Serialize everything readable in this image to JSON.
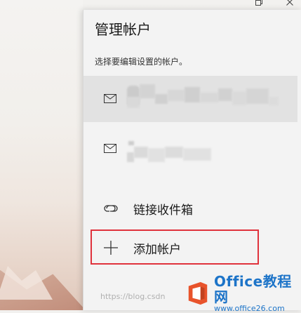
{
  "panel": {
    "title": "管理帐户",
    "subtitle": "选择要编辑设置的帐户。"
  },
  "accounts": [
    {
      "icon": "mail-icon",
      "selected": true
    },
    {
      "icon": "mail-icon",
      "selected": false
    }
  ],
  "menu": {
    "link_inbox": {
      "icon": "link-icon",
      "label": "链接收件箱"
    },
    "add_account": {
      "icon": "plus-icon",
      "label": "添加帐户"
    }
  },
  "watermark": {
    "text": "https://blog.csdn",
    "brand": "Office教程网",
    "url": "www.office26.com"
  },
  "colors": {
    "panel_bg": "#f3f3f3",
    "selected_row": "#e2e2e2",
    "highlight_border": "#e0323c",
    "brand_blue": "#1d74c8",
    "brand_orange": "#e8532b"
  }
}
